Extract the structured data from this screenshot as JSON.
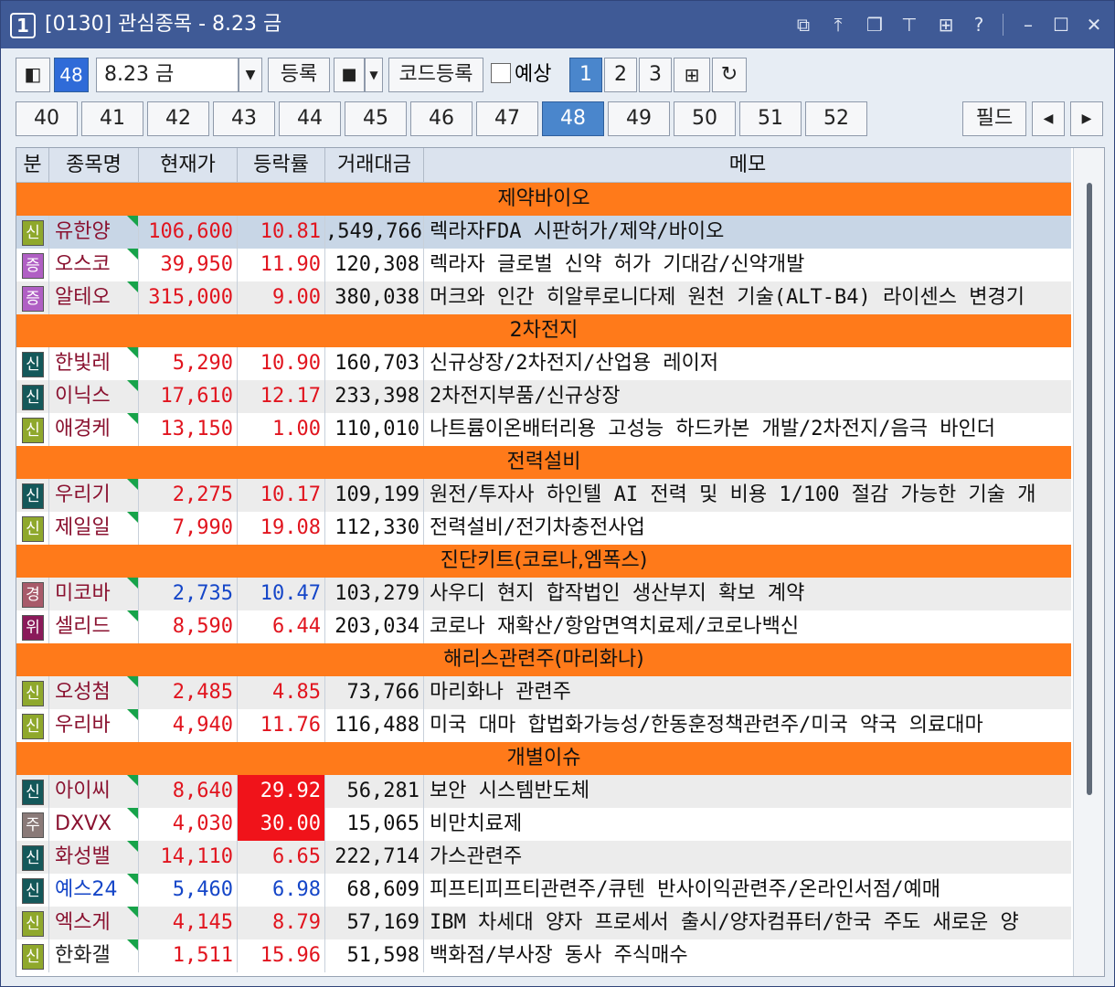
{
  "window": {
    "number": "1",
    "title": "[0130] 관심종목 - 8.23 금"
  },
  "title_icons": [
    "restore-window-icon",
    "move-top-icon",
    "cascade-icon",
    "pin-icon",
    "grid-icon",
    "help-icon",
    "minimize-icon",
    "maximize-icon",
    "close-icon"
  ],
  "toolbar": {
    "group_no": "48",
    "group_name": "8.23 금",
    "register_label": "등록",
    "code_register_label": "코드등록",
    "forecast_label": "예상",
    "pages": [
      "1",
      "2",
      "3"
    ],
    "active_page": "1"
  },
  "tabs": [
    "40",
    "41",
    "42",
    "43",
    "44",
    "45",
    "46",
    "47",
    "48",
    "49",
    "50",
    "51",
    "52"
  ],
  "active_tab": "48",
  "field_label": "필드",
  "columns": [
    "분",
    "종목명",
    "현재가",
    "등락률",
    "거래대금",
    "메모"
  ],
  "rows": [
    {
      "group": "제약바이오"
    },
    {
      "badge": "신",
      "badge_color": "#8fa82c",
      "name": "유한양",
      "price": "106,600",
      "rate": "10.81",
      "vol": ",549,766",
      "memo": "렉라자FDA 시판허가/제약/바이오",
      "dir": "up",
      "selected": true
    },
    {
      "badge": "증",
      "badge_color": "#b05fc4",
      "name": "오스코",
      "price": "39,950",
      "rate": "11.90",
      "vol": "120,308",
      "memo": "렉라자 글로벌 신약 허가 기대감/신약개발",
      "dir": "up"
    },
    {
      "badge": "증",
      "badge_color": "#b05fc4",
      "name": "알테오",
      "price": "315,000",
      "rate": "9.00",
      "vol": "380,038",
      "memo": "머크와 인간 히알루로니다제 원천 기술(ALT-B4) 라이센스 변경기",
      "dir": "up"
    },
    {
      "group": "2차전지"
    },
    {
      "badge": "신",
      "badge_color": "#14585a",
      "name": "한빛레",
      "price": "5,290",
      "rate": "10.90",
      "vol": "160,703",
      "memo": "신규상장/2차전지/산업용 레이저",
      "dir": "up"
    },
    {
      "badge": "신",
      "badge_color": "#14585a",
      "name": "이닉스",
      "price": "17,610",
      "rate": "12.17",
      "vol": "233,398",
      "memo": "2차전지부품/신규상장",
      "dir": "up"
    },
    {
      "badge": "신",
      "badge_color": "#8fa82c",
      "name": "애경케",
      "price": "13,150",
      "rate": "1.00",
      "vol": "110,010",
      "memo": "나트륨이온배터리용 고성능 하드카본 개발/2차전지/음극 바인더",
      "dir": "up"
    },
    {
      "group": "전력설비"
    },
    {
      "badge": "신",
      "badge_color": "#14585a",
      "name": "우리기",
      "price": "2,275",
      "rate": "10.17",
      "vol": "109,199",
      "memo": "원전/투자사 하인텔 AI 전력 및 비용 1/100 절감 가능한 기술 개",
      "dir": "up"
    },
    {
      "badge": "신",
      "badge_color": "#8fa82c",
      "name": "제일일",
      "price": "7,990",
      "rate": "19.08",
      "vol": "112,330",
      "memo": "전력설비/전기차충전사업",
      "dir": "up"
    },
    {
      "group": "진단키트(코로나,엠폭스)"
    },
    {
      "badge": "경",
      "badge_color": "#a85a6a",
      "name": "미코바",
      "price": "2,735",
      "rate": "10.47",
      "vol": "103,279",
      "memo": "사우디 현지 합작법인 생산부지 확보 계약",
      "dir": "dn"
    },
    {
      "badge": "위",
      "badge_color": "#8a1a5a",
      "name": "셀리드",
      "price": "8,590",
      "rate": "6.44",
      "vol": "203,034",
      "memo": "코로나 재확산/항암면역치료제/코로나백신",
      "dir": "up"
    },
    {
      "group": "해리스관련주(마리화나)"
    },
    {
      "badge": "신",
      "badge_color": "#8fa82c",
      "name": "오성첨",
      "price": "2,485",
      "rate": "4.85",
      "vol": "73,766",
      "memo": "마리화나 관련주",
      "dir": "up"
    },
    {
      "badge": "신",
      "badge_color": "#8fa82c",
      "name": "우리바",
      "price": "4,940",
      "rate": "11.76",
      "vol": "116,488",
      "memo": "미국 대마 합법화가능성/한동훈정책관련주/미국 약국 의료대마",
      "dir": "up"
    },
    {
      "group": "개별이슈"
    },
    {
      "badge": "신",
      "badge_color": "#14585a",
      "name": "아이씨",
      "price": "8,640",
      "rate": "29.92",
      "vol": "56,281",
      "memo": "보안 시스템반도체",
      "dir": "up",
      "limit": true
    },
    {
      "badge": "주",
      "badge_color": "#8a7a78",
      "name": "DXVX",
      "price": "4,030",
      "rate": "30.00",
      "vol": "15,065",
      "memo": "비만치료제",
      "dir": "up",
      "limit": true
    },
    {
      "badge": "신",
      "badge_color": "#14585a",
      "name": "화성밸",
      "price": "14,110",
      "rate": "6.65",
      "vol": "222,714",
      "memo": "가스관련주",
      "dir": "up"
    },
    {
      "badge": "신",
      "badge_color": "#14585a",
      "name": "예스24",
      "price": "5,460",
      "rate": "6.98",
      "vol": "68,609",
      "memo": "피프티피프티관련주/큐텐 반사이익관련주/온라인서점/예매",
      "dir": "dn",
      "name_dn": true
    },
    {
      "badge": "신",
      "badge_color": "#8fa82c",
      "name": "엑스게",
      "price": "4,145",
      "rate": "8.79",
      "vol": "57,169",
      "memo": "IBM 차세대 양자 프로세서 출시/양자컴퓨터/한국 주도 새로운 양",
      "dir": "up"
    },
    {
      "badge": "신",
      "badge_color": "#8fa82c",
      "name": "한화갤",
      "price": "1,511",
      "rate": "15.96",
      "vol": "51,598",
      "memo": "백화점/부사장 동사 주식매수",
      "dir": "up",
      "name_dark": true
    }
  ]
}
